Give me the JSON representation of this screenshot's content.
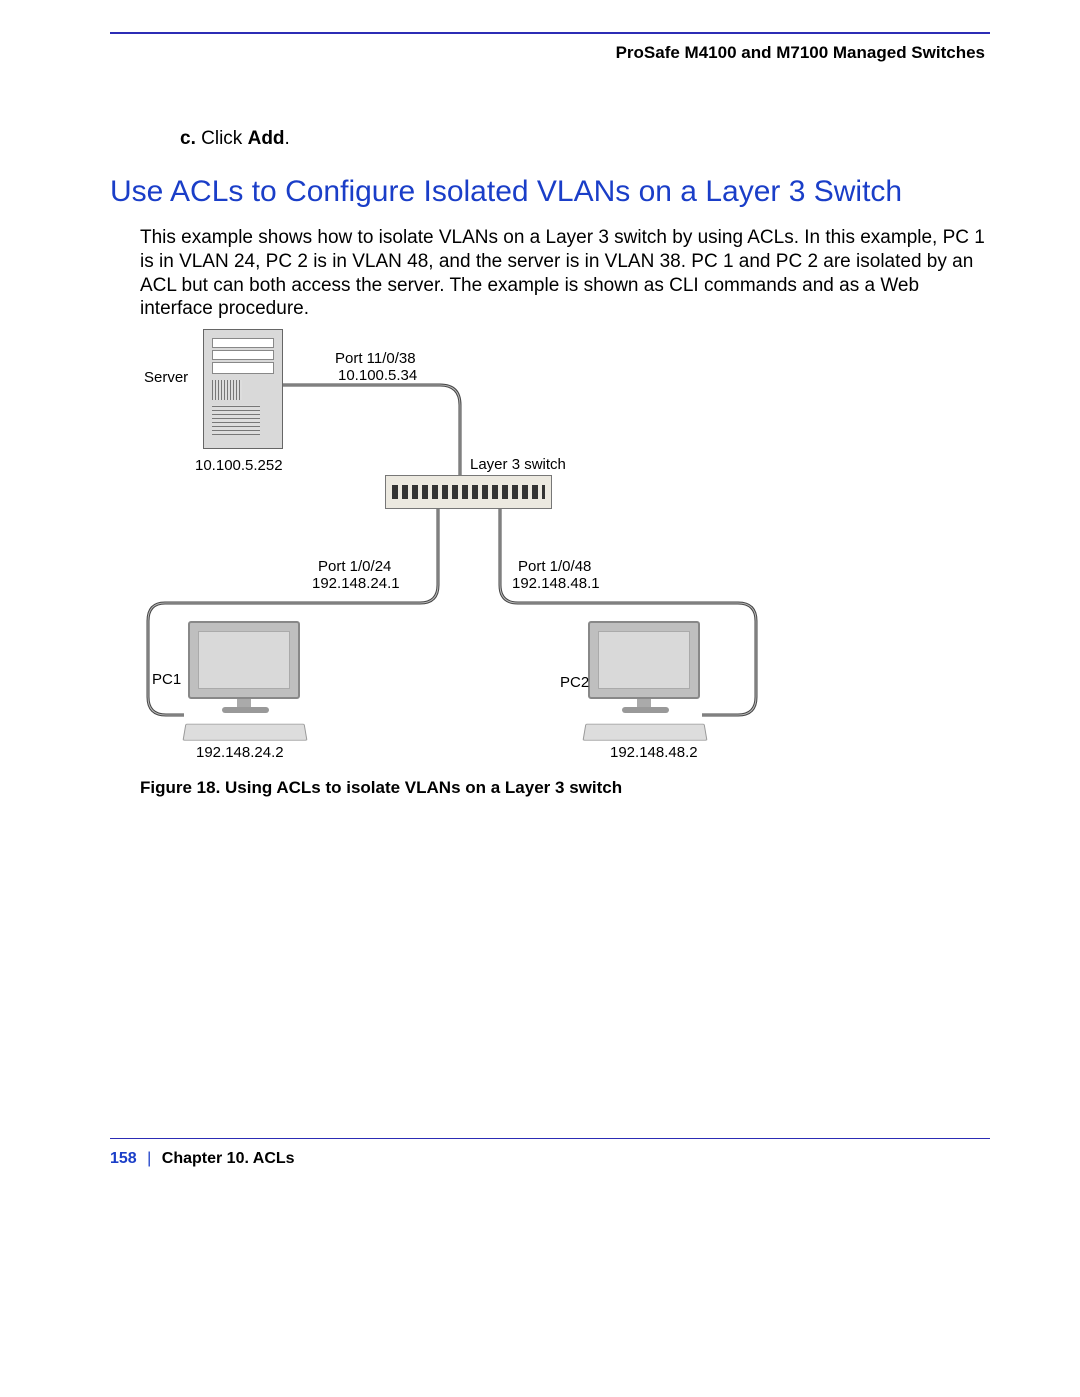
{
  "header": {
    "doc_title": "ProSafe M4100 and M7100 Managed Switches"
  },
  "step": {
    "marker": "c.",
    "text_before": "Click ",
    "bold": "Add",
    "period": "."
  },
  "heading": "Use ACLs to Configure Isolated VLANs on a Layer 3 Switch",
  "body": "This example shows how to isolate VLANs on a Layer 3 switch by using ACLs. In this example, PC 1 is in VLAN 24, PC 2 is in VLAN 48, and the server is in VLAN 38. PC 1 and PC 2 are isolated by an ACL but can both access the server. The example is shown as CLI commands and as a Web interface procedure.",
  "diagram": {
    "server_label": "Server",
    "server_ip": "10.100.5.252",
    "port38_line1": "Port 11/0/38",
    "port38_line2": "10.100.5.34",
    "switch_label": "Layer 3 switch",
    "port24_line1": "Port 1/0/24",
    "port24_line2": "192.148.24.1",
    "port48_line1": "Port 1/0/48",
    "port48_line2": "192.148.48.1",
    "pc1_label": "PC1",
    "pc1_ip": "192.148.24.2",
    "pc2_label": "PC2",
    "pc2_ip": "192.148.48.2"
  },
  "caption": "Figure 18. Using ACLs to isolate VLANs on a Layer 3 switch",
  "footer": {
    "page": "158",
    "chapter": "Chapter 10.  ACLs"
  }
}
